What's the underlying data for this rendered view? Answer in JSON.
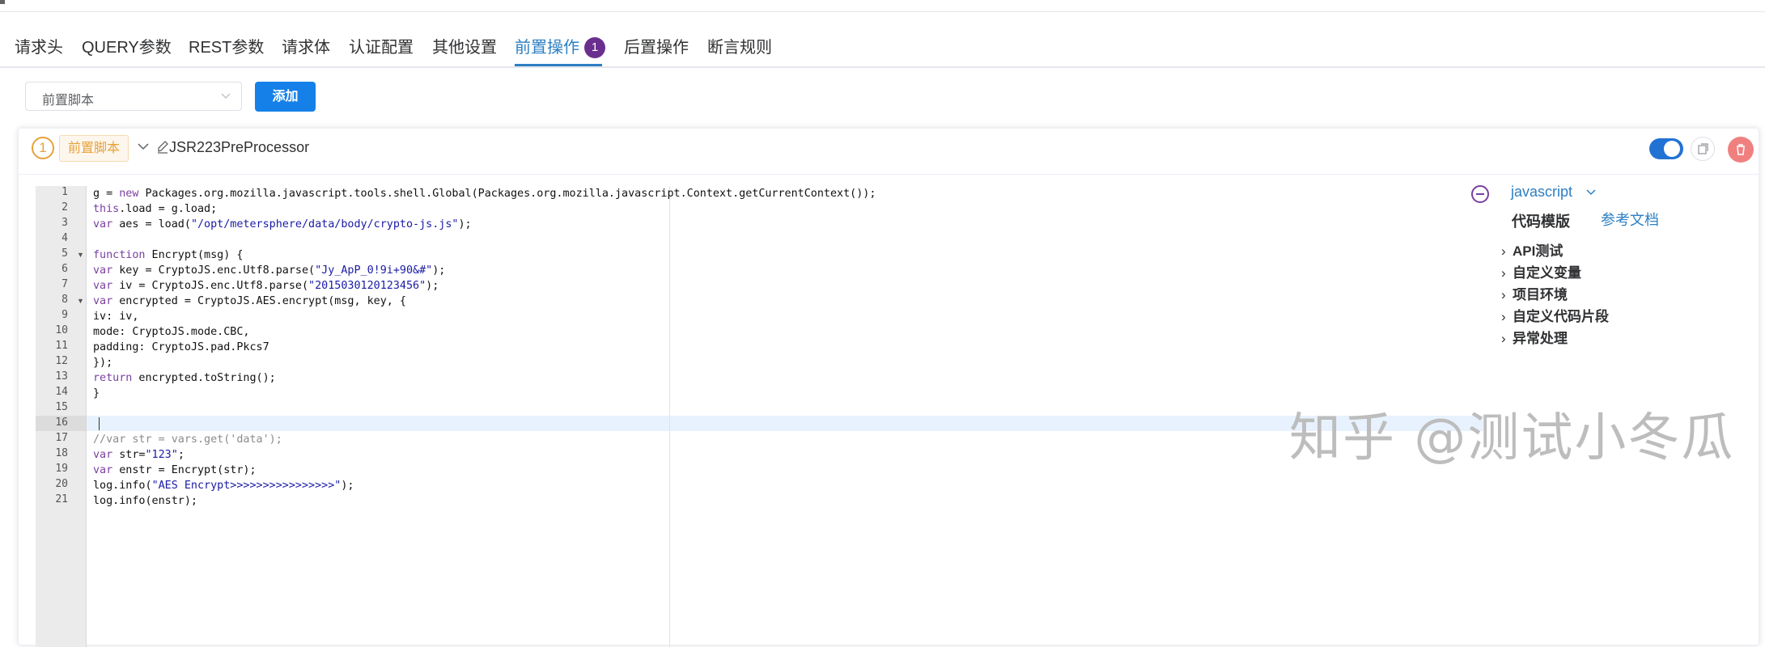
{
  "tabs": [
    {
      "label": "请求头"
    },
    {
      "label": "QUERY参数"
    },
    {
      "label": "REST参数"
    },
    {
      "label": "请求体"
    },
    {
      "label": "认证配置"
    },
    {
      "label": "其他设置"
    },
    {
      "label": "前置操作",
      "badge": "1",
      "active": true
    },
    {
      "label": "后置操作"
    },
    {
      "label": "断言规则"
    }
  ],
  "add_row": {
    "select_value": "前置脚本",
    "add_label": "添加"
  },
  "processor": {
    "index": "1",
    "tag": "前置脚本",
    "name": "JSR223PreProcessor",
    "enabled": true
  },
  "editor": {
    "active_line": 16,
    "line_numbers": [
      "1",
      "2",
      "3",
      "4",
      "5",
      "6",
      "7",
      "8",
      "9",
      "10",
      "11",
      "12",
      "13",
      "14",
      "15",
      "16",
      "17",
      "18",
      "19",
      "20",
      "21"
    ],
    "lines": [
      "g = new Packages.org.mozilla.javascript.tools.shell.Global(Packages.org.mozilla.javascript.Context.getCurrentContext());",
      "this.load = g.load;",
      "var aes = load(\"/opt/metersphere/data/body/crypto-js.js\");",
      "",
      "function Encrypt(msg) {",
      "var key = CryptoJS.enc.Utf8.parse(\"Jy_ApP_0!9i+90&#\");",
      "var iv = CryptoJS.enc.Utf8.parse(\"2015030120123456\");",
      "var encrypted = CryptoJS.AES.encrypt(msg, key, {",
      "iv: iv,",
      "mode: CryptoJS.mode.CBC,",
      "padding: CryptoJS.pad.Pkcs7",
      "});",
      "return encrypted.toString();",
      "}",
      "",
      "",
      "//var str = vars.get('data');",
      "var str=\"123\";",
      "var enstr = Encrypt(str);",
      "log.info(\"AES Encrypt>>>>>>>>>>>>>>>>\");",
      "log.info(enstr);"
    ]
  },
  "side_panel": {
    "language": "javascript",
    "template_label": "代码模版",
    "doc_label": "参考文档",
    "tree": [
      "API测试",
      "自定义变量",
      "项目环境",
      "自定义代码片段",
      "异常处理"
    ]
  },
  "watermark": "知乎 @测试小冬瓜",
  "colors": {
    "primary": "#2d7fc3",
    "button": "#1581e8",
    "badge": "#6a2f8e",
    "warning": "#e6a23c",
    "danger": "#f08080"
  }
}
